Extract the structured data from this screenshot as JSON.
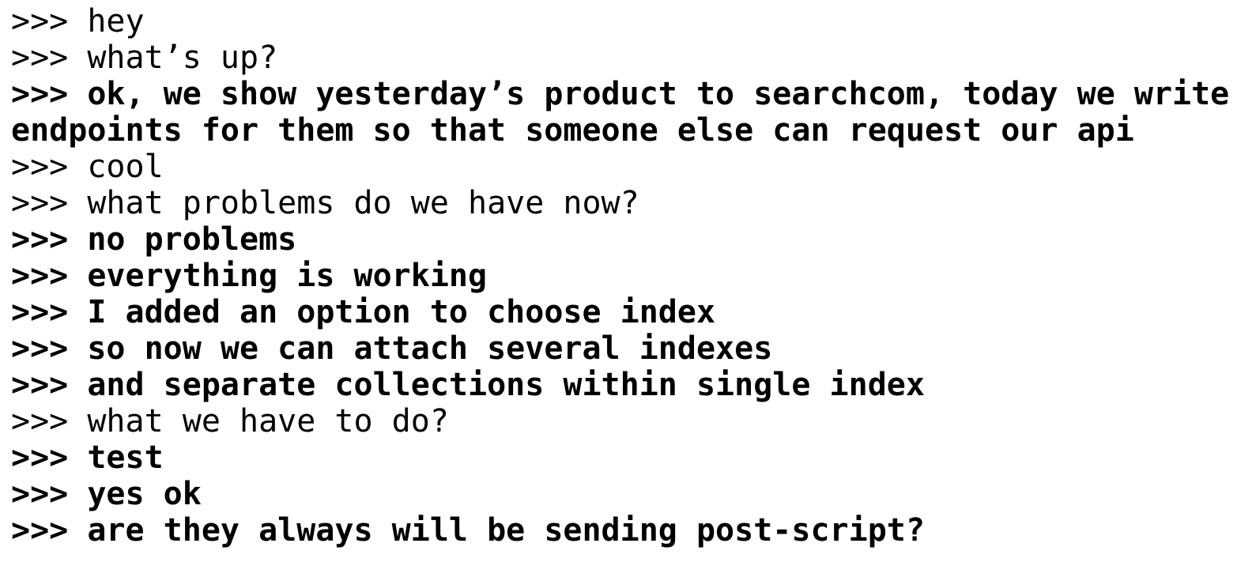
{
  "terminal": {
    "prompt": ">>>",
    "lines": [
      {
        "text": "hey",
        "bold": false
      },
      {
        "text": "what’s up?",
        "bold": false
      },
      {
        "text": "ok, we show yesterday’s product to searchcom, today we write endpoints for them so that someone else can request our api",
        "bold": true
      },
      {
        "text": "cool",
        "bold": false
      },
      {
        "text": "what problems do we have now?",
        "bold": false
      },
      {
        "text": "no problems",
        "bold": true
      },
      {
        "text": "everything is working",
        "bold": true
      },
      {
        "text": "I added an option to choose index",
        "bold": true
      },
      {
        "text": "so now we can attach several indexes",
        "bold": true
      },
      {
        "text": "and separate collections within single index",
        "bold": true
      },
      {
        "text": "what we have to do?",
        "bold": false
      },
      {
        "text": "test",
        "bold": true
      },
      {
        "text": "yes ok",
        "bold": true
      },
      {
        "text": "are they always will be sending post-script?",
        "bold": true
      }
    ]
  }
}
